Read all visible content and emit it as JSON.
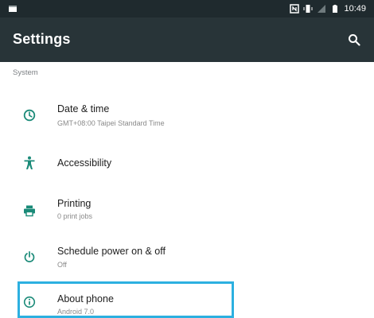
{
  "status_bar": {
    "time": "10:49",
    "icons": [
      "notification-icon",
      "nfc-icon",
      "vibrate-icon",
      "signal-icon",
      "battery-icon"
    ]
  },
  "app_bar": {
    "title": "Settings",
    "search_icon": "search-icon"
  },
  "section": {
    "header": "System"
  },
  "items": [
    {
      "title": "Date & time",
      "subtitle": "GMT+08:00 Taipei Standard Time",
      "icon": "clock-icon"
    },
    {
      "title": "Accessibility",
      "subtitle": "",
      "icon": "accessibility-icon"
    },
    {
      "title": "Printing",
      "subtitle": "0 print jobs",
      "icon": "printer-icon"
    },
    {
      "title": "Schedule power on & off",
      "subtitle": "Off",
      "icon": "power-icon"
    },
    {
      "title": "About phone",
      "subtitle": "Android 7.0",
      "icon": "info-icon"
    }
  ],
  "colors": {
    "status_bar": "#1f2a2e",
    "app_bar": "#283438",
    "icon_accent": "#1a8a78",
    "highlight_border": "#2cb0e0"
  }
}
